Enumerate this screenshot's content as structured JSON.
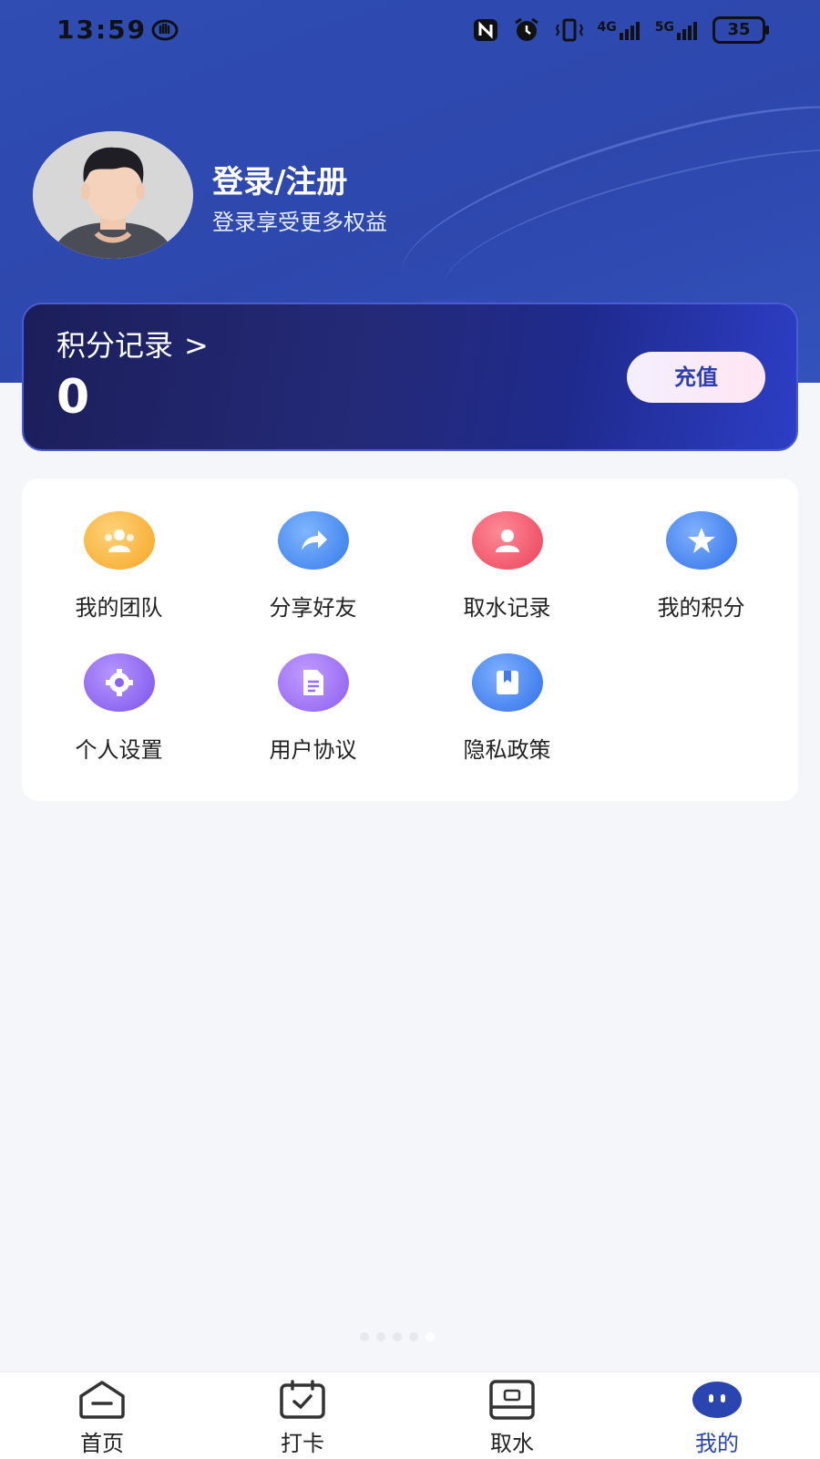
{
  "status_bar": {
    "time": "13:59",
    "net1": "4G",
    "net2": "5G",
    "battery": "35"
  },
  "profile": {
    "title": "登录/注册",
    "subtitle": "登录享受更多权益"
  },
  "points": {
    "title": "积分记录",
    "chevron": ">",
    "value": "0",
    "recharge_label": "充值"
  },
  "menu": [
    {
      "label": "我的团队",
      "icon": "team-icon",
      "color": "#f7b23a"
    },
    {
      "label": "分享好友",
      "icon": "share-icon",
      "color": "#3e8ef0"
    },
    {
      "label": "取水记录",
      "icon": "water-record-icon",
      "color": "#f0576b"
    },
    {
      "label": "我的积分",
      "icon": "star-icon",
      "color": "#3d7cf0"
    },
    {
      "label": "个人设置",
      "icon": "gear-icon",
      "color": "#8b63f0"
    },
    {
      "label": "用户协议",
      "icon": "document-icon",
      "color": "#9a6cf0"
    },
    {
      "label": "隐私政策",
      "icon": "bookmark-book-icon",
      "color": "#3d7cf0"
    }
  ],
  "tabbar": {
    "items": [
      {
        "label": "首页",
        "icon": "home-icon"
      },
      {
        "label": "打卡",
        "icon": "calendar-check-icon"
      },
      {
        "label": "取水",
        "icon": "water-machine-icon"
      },
      {
        "label": "我的",
        "icon": "profile-face-icon"
      }
    ],
    "active_index": 3,
    "active_color": "#2b45b0"
  }
}
